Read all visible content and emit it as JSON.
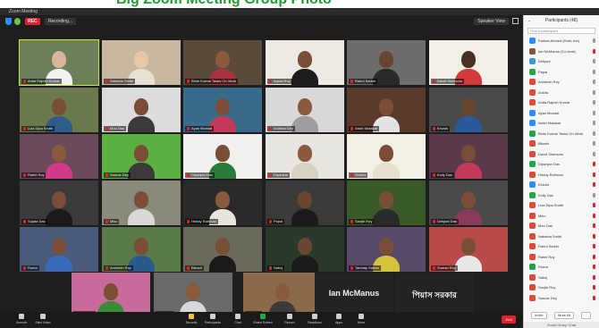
{
  "banner": {
    "text": "Big Zoom Meeting Group Photo"
  },
  "window": {
    "title": "Zoom Meeting"
  },
  "topbar": {
    "rec_label": "REC",
    "recording_label": "Recording...",
    "view_label": "Speaker View"
  },
  "tiles": [
    [
      {
        "name": "Anita Rajesh Kumar",
        "active": true,
        "bg": "#6b7f5a",
        "skin": "#d9b59a",
        "shirt": "#f2f2f2"
      },
      {
        "name": "Natasha Smith",
        "bg": "#c9b8a0",
        "skin": "#e6c7a8",
        "shirt": "#e8e0d0"
      },
      {
        "name": "Bhim Kumar Tasks On Work",
        "bg": "#5a4a3a",
        "skin": "#8a5a3c",
        "shirt": "#a8323e"
      },
      {
        "name": "Arpita Roy",
        "bg": "#ece8e2",
        "skin": "#7a4e36",
        "shirt": "#1c1c1c"
      },
      {
        "name": "Rahul Sarker",
        "bg": "#6d6d6d",
        "skin": "#6a4630",
        "shirt": "#2a2a2a"
      },
      {
        "name": "David Simmons",
        "bg": "#f2f0e6",
        "skin": "#4a3022",
        "shirt": "#d43a3a"
      }
    ],
    [
      {
        "name": "Liza Dipa Smith",
        "bg": "#6a7a4c",
        "skin": "#7a4e36",
        "shirt": "#2f5c8a"
      },
      {
        "name": "Mou Das",
        "bg": "#dcdcdc",
        "skin": "#7a4e36",
        "shirt": "#3a3a3a"
      },
      {
        "name": "Ayan Mondal",
        "bg": "#3a6a8a",
        "skin": "#7a4e36",
        "shirt": "#c23a5a"
      },
      {
        "name": "Anirban Dey",
        "bg": "#d8d8d8",
        "skin": "#8a5a3c",
        "shirt": "#9e9e9e"
      },
      {
        "name": "Asish Malakar",
        "bg": "#5a3a2a",
        "skin": "#7a4e36",
        "shirt": "#e2e2e2"
      },
      {
        "name": "Khushi",
        "bg": "#4a4a4a",
        "skin": "#6a4630",
        "shirt": "#2a5a9a"
      }
    ],
    [
      {
        "name": "Rakhi Roy",
        "bg": "#6a4a5a",
        "skin": "#8a5a3c",
        "shirt": "#d43a8a"
      },
      {
        "name": "Saurav Dey",
        "bg": "#5ab040",
        "skin": "#7a4e36",
        "shirt": "#3a3a3a"
      },
      {
        "name": "Dipanjan Das",
        "bg": "#f0f0ee",
        "skin": "#7a4e36",
        "shirt": "#2a7a3a"
      },
      {
        "name": "Dipankar",
        "bg": "#e8e6e0",
        "skin": "#8a5a3c",
        "shirt": "#d8d0c0"
      },
      {
        "name": "Sheela",
        "bg": "#f2efe4",
        "skin": "#7a4e36",
        "shirt": "#e6e0d0"
      },
      {
        "name": "Kolly Das",
        "bg": "#5a3a4a",
        "skin": "#7a4e36",
        "shirt": "#c23a5a"
      }
    ],
    [
      {
        "name": "Sujata Das",
        "bg": "#3a3a3a",
        "skin": "#7a4e36",
        "shirt": "#1a1a1a"
      },
      {
        "name": "Miko",
        "bg": "#8a8a7a",
        "skin": "#7a4e36",
        "shirt": "#d8d8d8"
      },
      {
        "name": "Hridoy Rahman",
        "bg": "#2a2a2a",
        "skin": "#8a5a3c",
        "shirt": "#e8e4dc"
      },
      {
        "name": "Papai",
        "bg": "#3a3a3a",
        "skin": "#6a4630",
        "shirt": "#1a1a1a"
      },
      {
        "name": "Sanjib Roy",
        "bg": "#3a5a2a",
        "skin": "#7a4e36",
        "shirt": "#2a2a2a"
      },
      {
        "name": "Debjani Das",
        "bg": "#4a4a4a",
        "skin": "#7a4e36",
        "shirt": "#8a3a5a"
      }
    ],
    [
      {
        "name": "Ruma",
        "bg": "#4a5a7a",
        "skin": "#7a4e36",
        "shirt": "#3a6aba"
      },
      {
        "name": "Animesh Roy",
        "bg": "#5a7a4a",
        "skin": "#7a4e36",
        "shirt": "#2a5a8a"
      },
      {
        "name": "Bikash",
        "bg": "#6a6a5a",
        "skin": "#7a4e36",
        "shirt": "#1a1a1a"
      },
      {
        "name": "Sabuj",
        "bg": "#2a3a2a",
        "skin": "#6a4630",
        "shirt": "#1a1a1a"
      },
      {
        "name": "Tanmay Sarkar",
        "bg": "#5a4a6a",
        "skin": "#7a4e36",
        "shirt": "#d4c43a"
      },
      {
        "name": "Suman Roy",
        "bg": "#b84a4a",
        "skin": "#7a4e36",
        "shirt": "#e8e8e8"
      }
    ],
    [
      {
        "name": "Bapi Das",
        "bg": "#c86a9a",
        "skin": "#7a4e36",
        "shirt": "#3a8a3a"
      },
      {
        "name": "Ankita",
        "bg": "#6a6a6a",
        "skin": "#8a5a3c",
        "shirt": "#d8d8d8"
      },
      {
        "name": "Soma",
        "bg": "#8a6a4a",
        "skin": "#8a5a3c",
        "shirt": "#3a3a3a"
      },
      {
        "name": "Ian McManus",
        "textonly": true
      },
      {
        "name": "পিয়াস সরকার",
        "textonly": true
      }
    ]
  ],
  "toolbar": {
    "items": [
      "Unmute",
      "Start Video",
      "Security",
      "Participants",
      "Chat",
      "Share Screen",
      "Record",
      "Reactions",
      "Apps",
      "More"
    ],
    "end_label": "End"
  },
  "panel": {
    "title": "Participants (48)",
    "search_placeholder": "Find a participant",
    "participants": [
      {
        "name": "Farhan Ahmed (Host, me)",
        "color": "#2d8cff",
        "muted": false
      },
      {
        "name": "Ian McManus (Co-host)",
        "color": "#7a5a3a",
        "muted": true
      },
      {
        "name": "Debjani",
        "color": "#3a9ad9",
        "muted": false
      },
      {
        "name": "Papai",
        "color": "#1fa84a",
        "muted": false
      },
      {
        "name": "Animesh Roy",
        "color": "#e04a3a",
        "muted": false
      },
      {
        "name": "Ankita",
        "color": "#e04a3a",
        "muted": false
      },
      {
        "name": "Anita Rajesh Kumar",
        "color": "#e04a3a",
        "muted": false
      },
      {
        "name": "Ayan Mondal",
        "color": "#2d8cff",
        "muted": false
      },
      {
        "name": "Asish Malakar",
        "color": "#2d8cff",
        "muted": false
      },
      {
        "name": "Bhim Kumar Tasks On Work",
        "color": "#1fa84a",
        "muted": false
      },
      {
        "name": "Bikash",
        "color": "#e04a3a",
        "muted": false
      },
      {
        "name": "David Simmons",
        "color": "#e04a3a",
        "muted": false
      },
      {
        "name": "Dipanjan Das",
        "color": "#1fa84a",
        "muted": true
      },
      {
        "name": "Hridoy Rahman",
        "color": "#e04a3a",
        "muted": true
      },
      {
        "name": "Khushi",
        "color": "#2d8cff",
        "muted": true
      },
      {
        "name": "Kolly Das",
        "color": "#1fa84a",
        "muted": false
      },
      {
        "name": "Liza Dipa Smith",
        "color": "#e04a3a",
        "muted": true
      },
      {
        "name": "Miko",
        "color": "#e04a3a",
        "muted": true
      },
      {
        "name": "Mou Das",
        "color": "#e04a3a",
        "muted": true
      },
      {
        "name": "Natasha Smith",
        "color": "#e04a3a",
        "muted": true
      },
      {
        "name": "Rahul Sarker",
        "color": "#e04a3a",
        "muted": true
      },
      {
        "name": "Rakhi Roy",
        "color": "#e04a3a",
        "muted": true
      },
      {
        "name": "Ruma",
        "color": "#1fa84a",
        "muted": true
      },
      {
        "name": "Sabuj",
        "color": "#e04a3a",
        "muted": true
      },
      {
        "name": "Sanjib Roy",
        "color": "#e04a3a",
        "muted": true
      },
      {
        "name": "Saurav Dey",
        "color": "#e04a3a",
        "muted": true
      }
    ],
    "invite_label": "Invite",
    "mute_all_label": "Mute All",
    "more_label": "...",
    "chat_label": "Zoom Group Chat"
  },
  "colors": {
    "accent": "#2d8cff",
    "danger": "#e0222b",
    "active_speaker": "#c8e632"
  }
}
